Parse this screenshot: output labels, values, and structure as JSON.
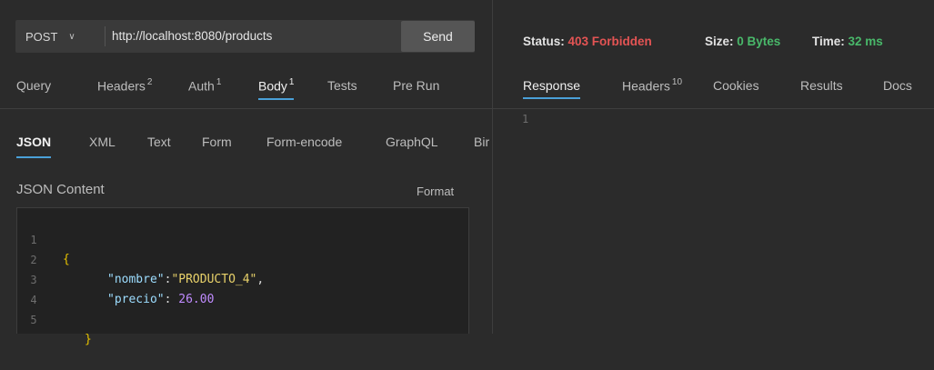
{
  "request": {
    "method": "POST",
    "url": "http://localhost:8080/products",
    "send_label": "Send"
  },
  "request_tabs": [
    {
      "label": "Query",
      "badge": ""
    },
    {
      "label": "Headers",
      "badge": "2"
    },
    {
      "label": "Auth",
      "badge": "1"
    },
    {
      "label": "Body",
      "badge": "1",
      "active": true
    },
    {
      "label": "Tests",
      "badge": ""
    },
    {
      "label": "Pre Run",
      "badge": ""
    }
  ],
  "body_tabs": [
    "JSON",
    "XML",
    "Text",
    "Form",
    "Form-encode",
    "GraphQL",
    "Bir"
  ],
  "body_active": "JSON",
  "json_content_label": "JSON Content",
  "format_label": "Format",
  "editor_lines": [
    {
      "num": "1"
    },
    {
      "num": "2",
      "key": "\"nombre\"",
      "sep": ":",
      "value": "\"PRODUCTO_4\"",
      "tail": ","
    },
    {
      "num": "3",
      "key": "\"precio\"",
      "sep": ": ",
      "value": "26.00",
      "tail": ""
    },
    {
      "num": "4"
    },
    {
      "num": "5"
    }
  ],
  "brace_open": "{",
  "brace_close": "}",
  "response": {
    "status_label": "Status:",
    "status_value": "403 Forbidden",
    "size_label": "Size:",
    "size_value": "0 Bytes",
    "time_label": "Time:",
    "time_value": "32 ms",
    "line_number": "1"
  },
  "response_tabs": [
    {
      "label": "Response",
      "badge": "",
      "active": true
    },
    {
      "label": "Headers",
      "badge": "10"
    },
    {
      "label": "Cookies",
      "badge": ""
    },
    {
      "label": "Results",
      "badge": ""
    },
    {
      "label": "Docs",
      "badge": ""
    }
  ],
  "colors": {
    "accent": "#4aa0d8",
    "status_error": "#e45454",
    "status_ok": "#49b86a",
    "background": "#2b2b2b"
  }
}
